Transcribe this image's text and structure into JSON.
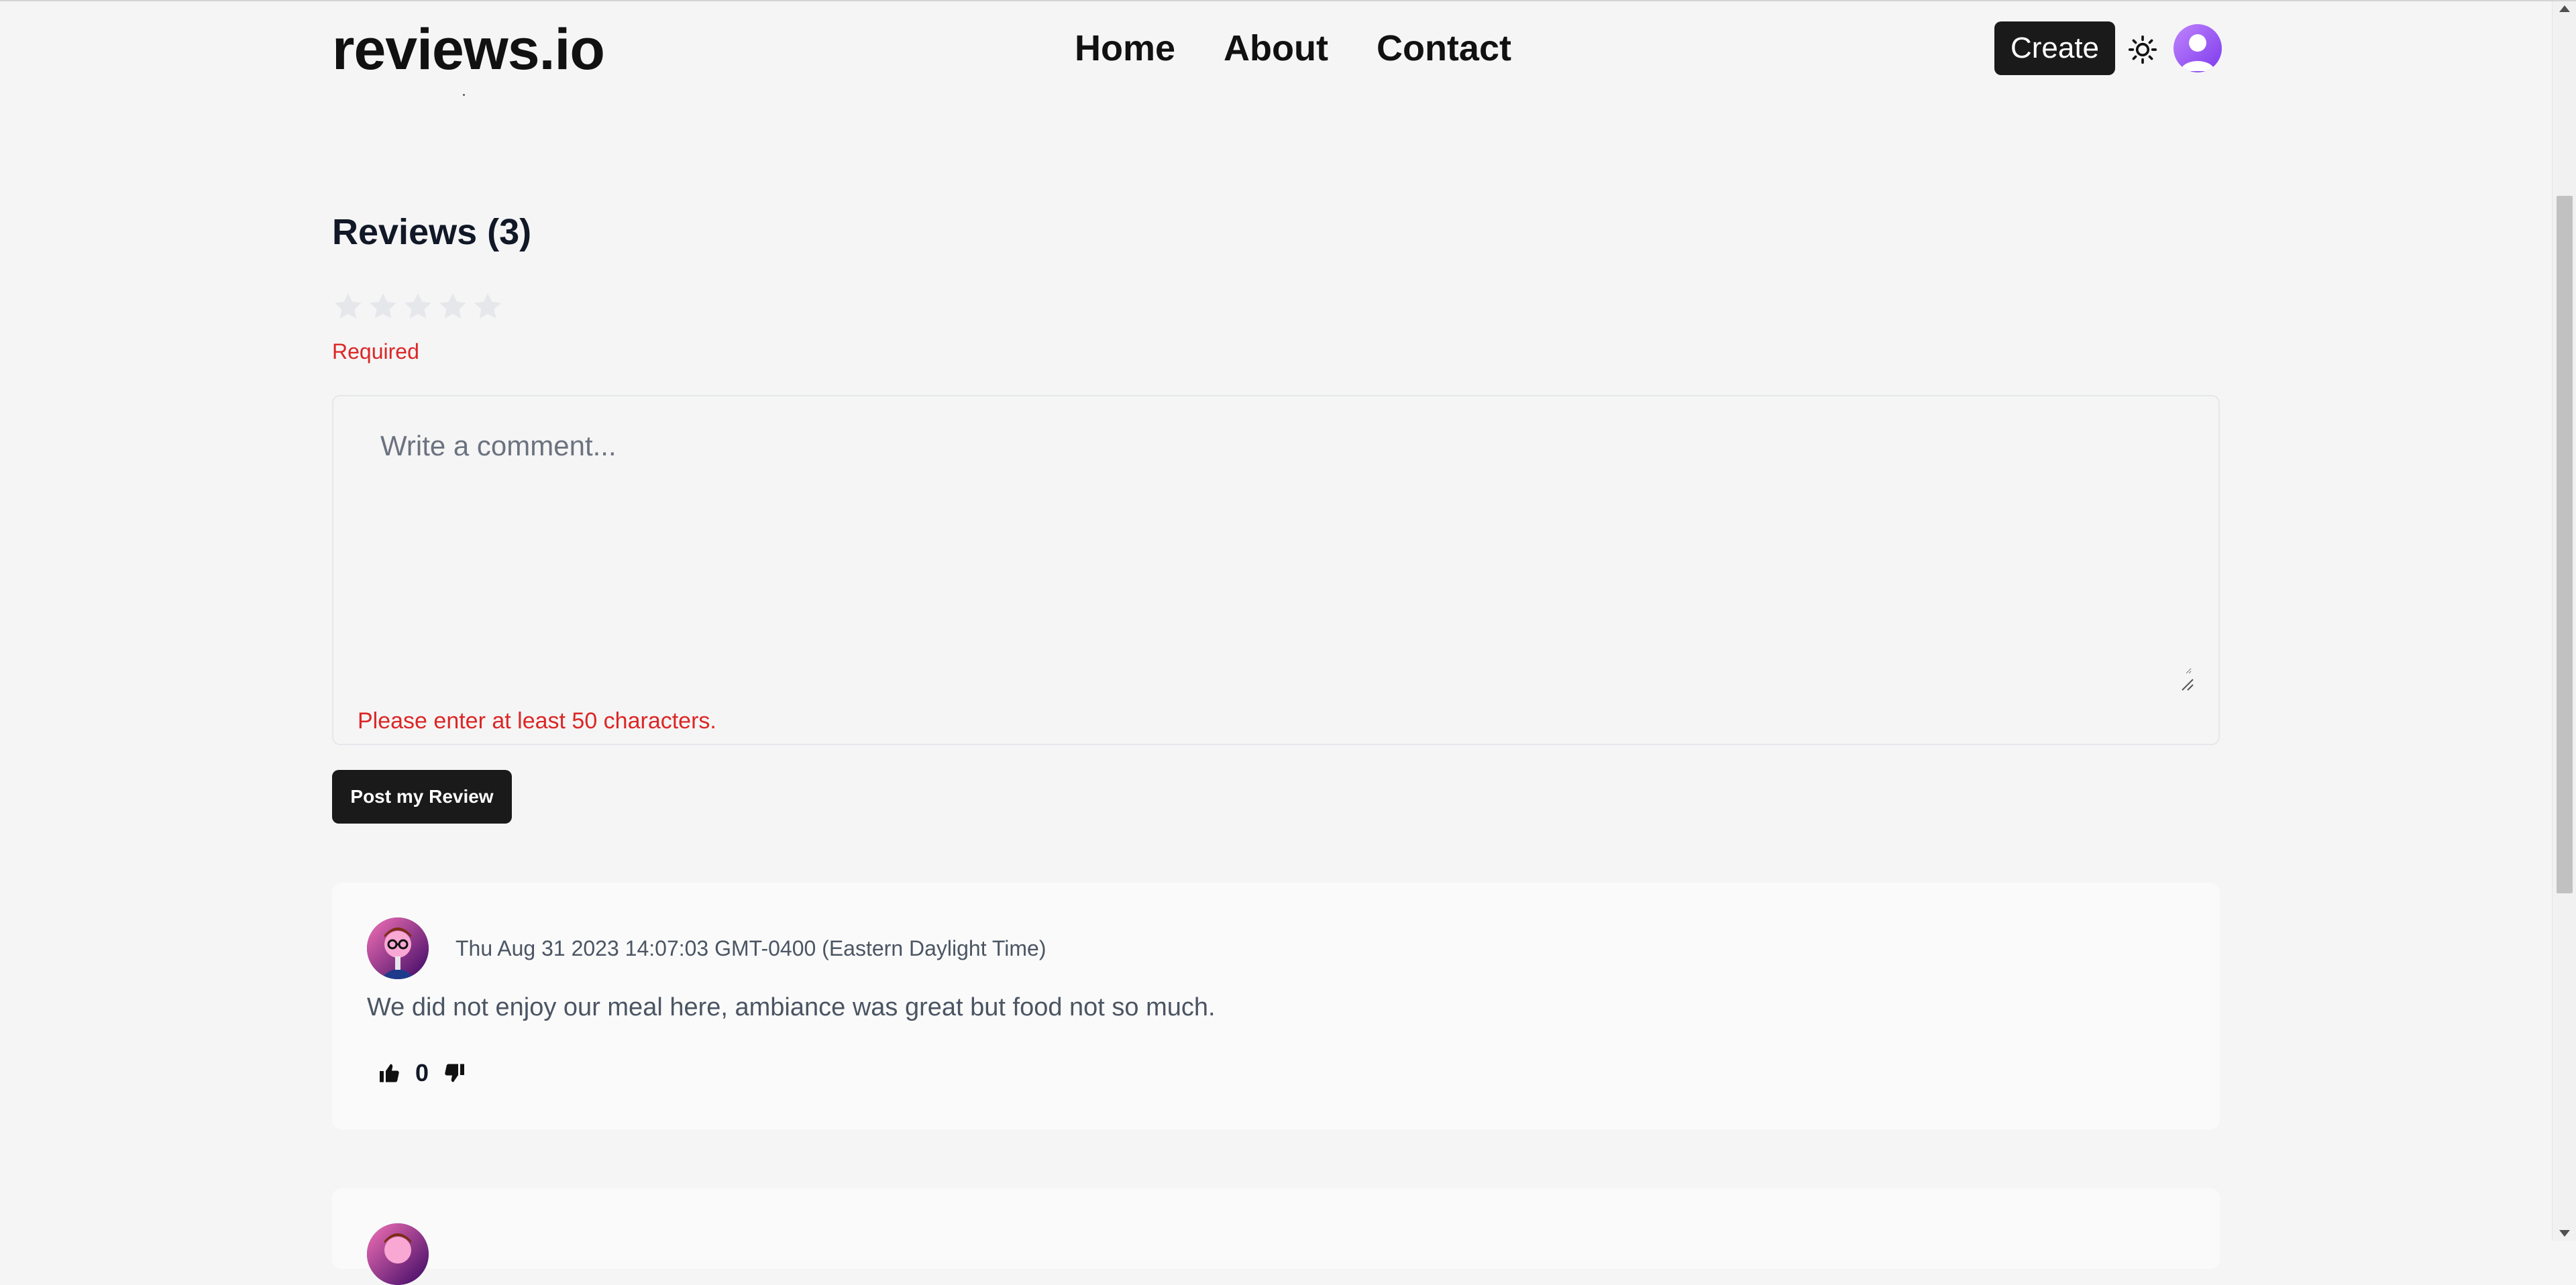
{
  "header": {
    "logo": "reviews.io",
    "nav": [
      "Home",
      "About",
      "Contact"
    ],
    "create_label": "Create",
    "theme_icon": "sun-icon",
    "avatar_icon": "user-avatar-icon"
  },
  "reviews_section": {
    "title": "Reviews (3)",
    "rating": {
      "max_stars": 5,
      "selected": 0
    },
    "required_text": "Required",
    "comment": {
      "placeholder": "Write a comment...",
      "value": "",
      "error": "Please enter at least 50 characters."
    },
    "post_label": "Post my Review"
  },
  "reviews": [
    {
      "date": "Thu Aug 31 2023 14:07:03 GMT-0400 (Eastern Daylight Time)",
      "text": "We did not enjoy our meal here, ambiance was great but food not so much.",
      "votes": "0"
    }
  ],
  "colors": {
    "accent": "#1a1a1a",
    "error": "#dc2626",
    "background": "#f5f5f5",
    "avatar_gradient": [
      "#c084fc",
      "#7c3aed"
    ]
  }
}
